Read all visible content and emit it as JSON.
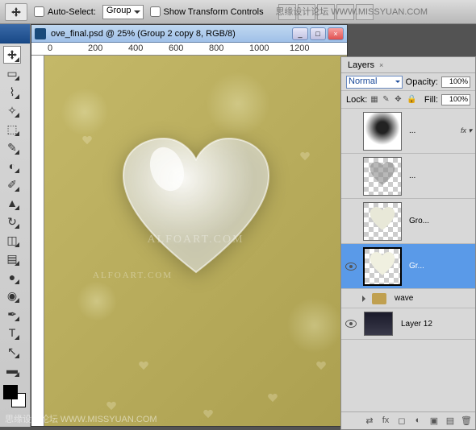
{
  "watermarks": {
    "top_cn": "思缘设计论坛",
    "top_url": "WWW.MISSYUAN.COM",
    "canvas_main": "ALFOART.COM",
    "canvas_small": "ALFOART.COM",
    "bottom_cn": "思缘设计论坛",
    "bottom_url": "WWW.MISSYUAN.COM"
  },
  "options_bar": {
    "auto_select_label": "Auto-Select:",
    "group_dropdown": "Group",
    "show_transform_label": "Show Transform Controls"
  },
  "document": {
    "title": "ove_final.psd @ 25% (Group 2 copy 8, RGB/8)",
    "ruler_marks": [
      "0",
      "200",
      "400",
      "600",
      "800",
      "1000",
      "1200"
    ]
  },
  "layers_panel": {
    "tab_label": "Layers",
    "blend_mode": "Normal",
    "opacity_label": "Opacity:",
    "opacity_value": "100%",
    "lock_label": "Lock:",
    "fill_label": "Fill:",
    "fill_value": "100%",
    "layers": [
      {
        "name": "...",
        "fx": true
      },
      {
        "name": "..."
      },
      {
        "name": "Gro..."
      },
      {
        "name": "Gr...",
        "selected": true,
        "visible": true
      },
      {
        "name": "wave",
        "type": "group"
      },
      {
        "name": "Layer 12",
        "visible": true
      }
    ]
  }
}
